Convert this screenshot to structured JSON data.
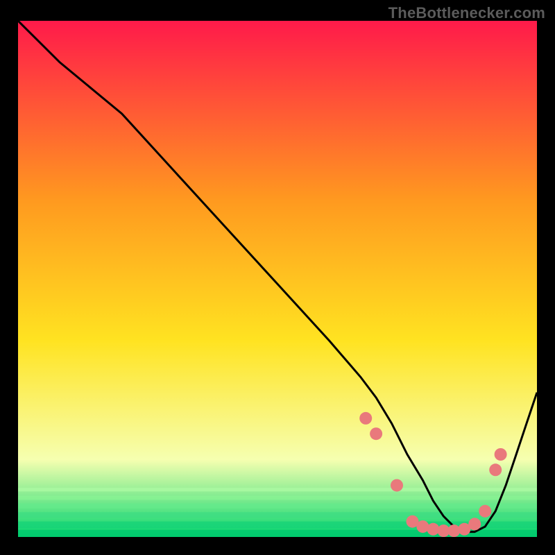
{
  "watermark": "TheBottlenecker.com",
  "chart_data": {
    "type": "line",
    "title": "",
    "xlabel": "",
    "ylabel": "",
    "xlim": [
      0,
      100
    ],
    "ylim": [
      0,
      100
    ],
    "gradient": {
      "top": "#ff1a4a",
      "mid_upper": "#ff9a1f",
      "mid": "#ffe321",
      "mid_lower": "#f6ffb0",
      "low": "#06d66e"
    },
    "series": [
      {
        "name": "curve",
        "color": "#000000",
        "x": [
          0,
          8,
          14,
          20,
          30,
          40,
          50,
          60,
          66,
          69,
          72,
          75,
          78,
          80,
          82,
          84,
          86,
          88,
          90,
          92,
          94,
          96,
          98,
          100
        ],
        "y": [
          100,
          92,
          87,
          82,
          71,
          60,
          49,
          38,
          31,
          27,
          22,
          16,
          11,
          7,
          4,
          2,
          1,
          1,
          2,
          5,
          10,
          16,
          22,
          28
        ]
      },
      {
        "name": "markers",
        "color": "#e9797c",
        "x": [
          67,
          69,
          73,
          76,
          78,
          80,
          82,
          84,
          86,
          88,
          90,
          92,
          93
        ],
        "y": [
          23,
          20,
          10,
          3,
          2,
          1.5,
          1.2,
          1.2,
          1.5,
          2.5,
          5,
          13,
          16
        ]
      }
    ]
  }
}
